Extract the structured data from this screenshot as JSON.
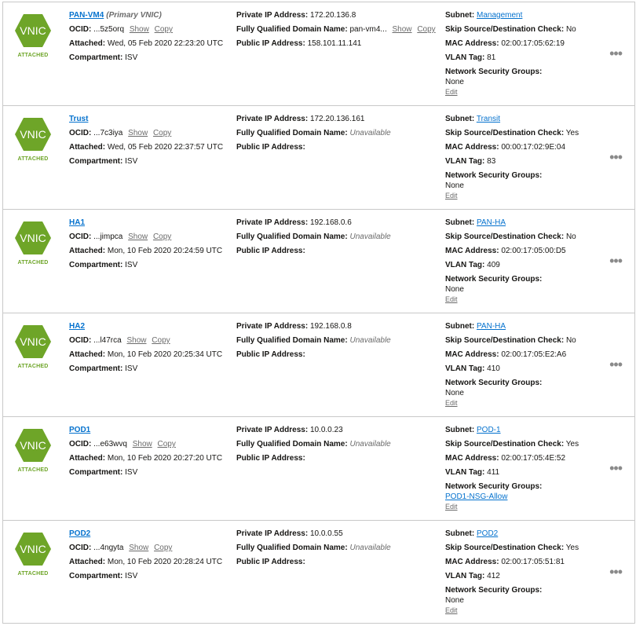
{
  "labels": {
    "ocid": "OCID:",
    "attached": "Attached:",
    "compartment": "Compartment:",
    "private_ip": "Private IP Address:",
    "fqdn": "Fully Qualified Domain Name:",
    "public_ip": "Public IP Address:",
    "subnet": "Subnet:",
    "skip_check": "Skip Source/Destination Check:",
    "mac": "MAC Address:",
    "vlan": "VLAN Tag:",
    "nsg": "Network Security Groups:",
    "show": "Show",
    "copy": "Copy",
    "edit": "Edit",
    "more": "•••",
    "badge_text": "VNIC",
    "status": "ATTACHED"
  },
  "colors": {
    "badge_green": "#6ea528",
    "link_blue": "#0572ce"
  },
  "vnics": [
    {
      "name": "PAN-VM4",
      "primary_note": "(Primary VNIC)",
      "ocid": "...5z5orq",
      "attached": "Wed, 05 Feb 2020 22:23:20 UTC",
      "compartment": "ISV",
      "private_ip": "172.20.136.8",
      "fqdn": "pan-vm4...",
      "fqdn_available": true,
      "public_ip": "158.101.11.141",
      "subnet": "Management",
      "skip_check": "No",
      "mac": "02:00:17:05:62:19",
      "vlan": "81",
      "nsg": "None",
      "nsg_link": false
    },
    {
      "name": "Trust",
      "primary_note": "",
      "ocid": "...7c3iya",
      "attached": "Wed, 05 Feb 2020 22:37:57 UTC",
      "compartment": "ISV",
      "private_ip": "172.20.136.161",
      "fqdn": "Unavailable",
      "fqdn_available": false,
      "public_ip": "",
      "subnet": "Transit",
      "skip_check": "Yes",
      "mac": "00:00:17:02:9E:04",
      "vlan": "83",
      "nsg": "None",
      "nsg_link": false
    },
    {
      "name": "HA1",
      "primary_note": "",
      "ocid": "...jimpca",
      "attached": "Mon, 10 Feb 2020 20:24:59 UTC",
      "compartment": "ISV",
      "private_ip": "192.168.0.6",
      "fqdn": "Unavailable",
      "fqdn_available": false,
      "public_ip": "",
      "subnet": "PAN-HA",
      "skip_check": "No",
      "mac": "02:00:17:05:00:D5",
      "vlan": "409",
      "nsg": "None",
      "nsg_link": false
    },
    {
      "name": "HA2",
      "primary_note": "",
      "ocid": "...l47rca",
      "attached": "Mon, 10 Feb 2020 20:25:34 UTC",
      "compartment": "ISV",
      "private_ip": "192.168.0.8",
      "fqdn": "Unavailable",
      "fqdn_available": false,
      "public_ip": "",
      "subnet": "PAN-HA",
      "skip_check": "No",
      "mac": "02:00:17:05:E2:A6",
      "vlan": "410",
      "nsg": "None",
      "nsg_link": false
    },
    {
      "name": "POD1",
      "primary_note": "",
      "ocid": "...e63wvq",
      "attached": "Mon, 10 Feb 2020 20:27:20 UTC",
      "compartment": "ISV",
      "private_ip": "10.0.0.23",
      "fqdn": "Unavailable",
      "fqdn_available": false,
      "public_ip": "",
      "subnet": "POD-1",
      "skip_check": "Yes",
      "mac": "02:00:17:05:4E:52",
      "vlan": "411",
      "nsg": "POD1-NSG-Allow",
      "nsg_link": true
    },
    {
      "name": "POD2",
      "primary_note": "",
      "ocid": "...4ngyta",
      "attached": "Mon, 10 Feb 2020 20:28:24 UTC",
      "compartment": "ISV",
      "private_ip": "10.0.0.55",
      "fqdn": "Unavailable",
      "fqdn_available": false,
      "public_ip": "",
      "subnet": "POD2",
      "skip_check": "Yes",
      "mac": "02:00:17:05:51:81",
      "vlan": "412",
      "nsg": "None",
      "nsg_link": false
    }
  ]
}
